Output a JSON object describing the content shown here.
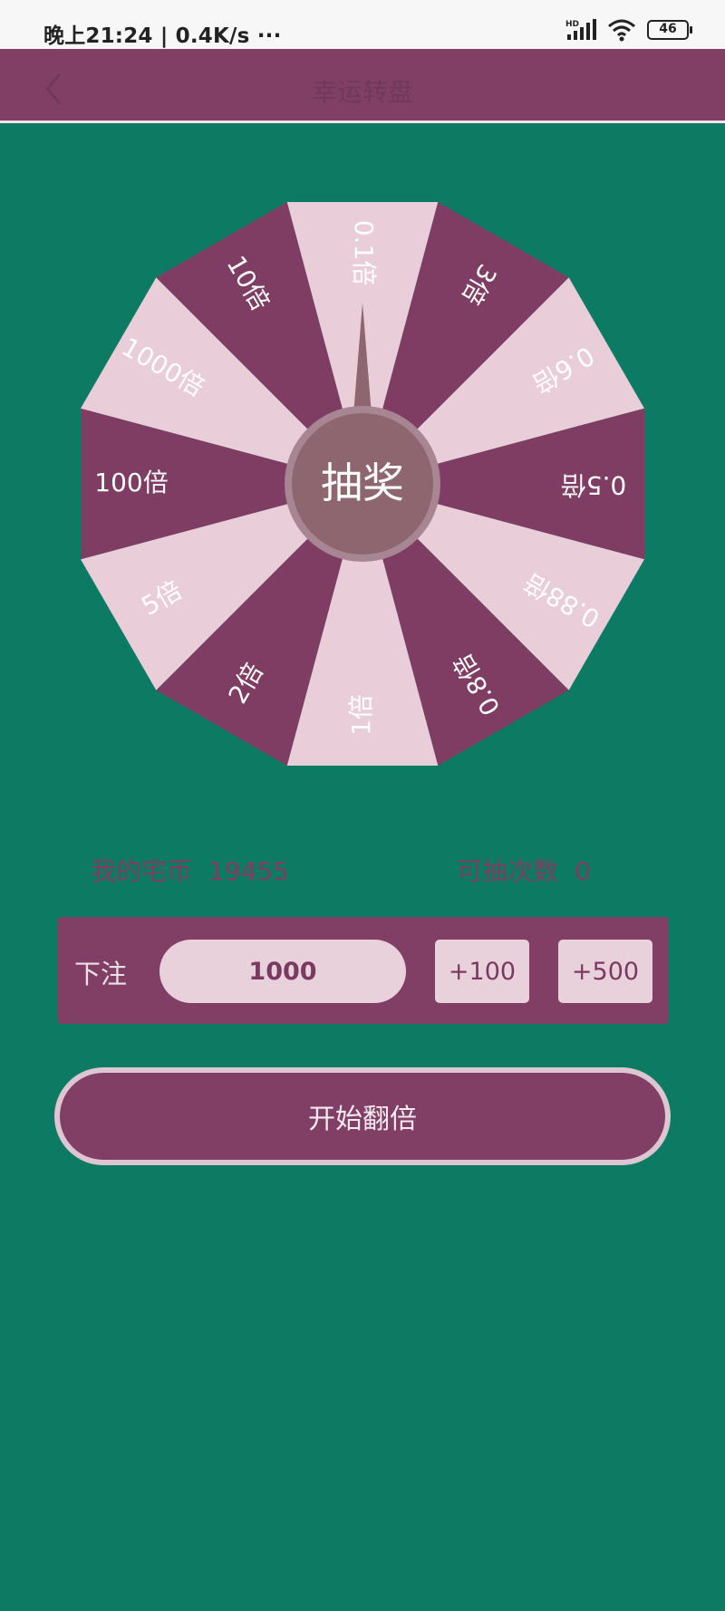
{
  "status_bar": {
    "time_speed": "晚上21:24 | 0.4K/s ···",
    "network": "HD",
    "battery": "46"
  },
  "app_bar": {
    "title": "幸运转盘",
    "back_icon": "chevron-left-icon"
  },
  "wheel": {
    "center_label": "抽奖",
    "segments": [
      "0.1倍",
      "3倍",
      "0.6倍",
      "0.5倍",
      "0.88倍",
      "0.8倍",
      "1倍",
      "2倍",
      "5倍",
      "100倍",
      "1000倍",
      "10倍"
    ],
    "colors": {
      "light": "#e9cdd9",
      "dark": "#7f3d63",
      "hub": "#8e6670",
      "hub_ring": "#a88593",
      "pointer": "#8e6670"
    }
  },
  "info": {
    "coins_label": "我的宅币",
    "coins_value": "19455",
    "draws_label": "可抽次数",
    "draws_value": "0"
  },
  "bet": {
    "label": "下注",
    "value": "1000",
    "add_100": "+100",
    "add_500": "+500"
  },
  "start_button": "开始翻倍",
  "colors": {
    "background": "#0d7b64",
    "primary": "#823f66",
    "light_pink": "#e9d1dc"
  }
}
